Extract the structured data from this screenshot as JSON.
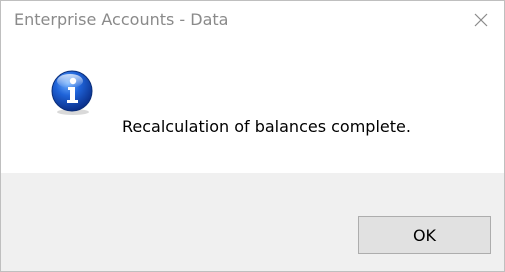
{
  "window": {
    "title": "Enterprise Accounts - Data",
    "close_icon": "close-icon"
  },
  "dialog": {
    "icon": "information-icon",
    "message": "Recalculation of balances complete."
  },
  "buttons": {
    "ok_label": "OK"
  }
}
